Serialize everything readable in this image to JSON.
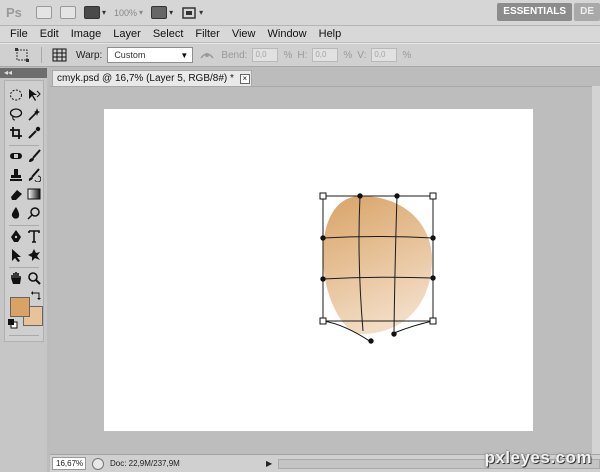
{
  "app": {
    "logo": "Ps",
    "bridge_label": "Br",
    "minibridge_label": "Mb",
    "zoom_percent": "100%",
    "workspace_active": "ESSENTIALS",
    "workspace_next": "DE"
  },
  "menu": [
    "File",
    "Edit",
    "Image",
    "Layer",
    "Select",
    "Filter",
    "View",
    "Window",
    "Help"
  ],
  "options": {
    "warp_label": "Warp:",
    "warp_value": "Custom",
    "bend_label": "Bend:",
    "bend_value": "0,0",
    "h_label": "H:",
    "h_value": "0,0",
    "v_label": "V:",
    "v_value": "0,0",
    "percent": "%"
  },
  "toolpanel": {
    "collapse": "◂◂"
  },
  "document": {
    "tab_title": "cmyk.psd @ 16,7% (Layer 5, RGB/8#) *",
    "close_glyph": "×"
  },
  "status": {
    "zoom": "16,67%",
    "doc_info": "Doc: 22,9M/237,9M"
  },
  "colors": {
    "foreground": "#d9a366",
    "background": "#e8c39a",
    "egg_light": "#f2dcc4",
    "egg_dark": "#d9a366"
  },
  "watermark": "pxleyes.com"
}
